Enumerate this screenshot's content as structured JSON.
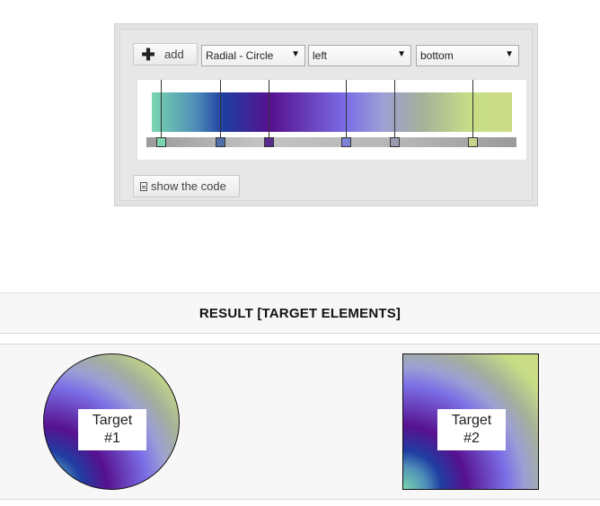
{
  "toolbar": {
    "add_label": "add",
    "gradient_type": "Radial - Circle",
    "horizontal_position": "left",
    "vertical_position": "bottom"
  },
  "gradient": {
    "stops": [
      {
        "position_percent": 4,
        "color": "#79d6ae"
      },
      {
        "position_percent": 20,
        "color": "#4f6fa8"
      },
      {
        "position_percent": 33,
        "color": "#5b2a8c"
      },
      {
        "position_percent": 54,
        "color": "#7b82d6"
      },
      {
        "position_percent": 67,
        "color": "#9a9ab0"
      },
      {
        "position_percent": 88,
        "color": "#c6d48e"
      }
    ]
  },
  "show_code_label": "show the code",
  "result": {
    "title": "RESULT [TARGET ELEMENTS]",
    "targets": [
      {
        "label": "Target\n#1"
      },
      {
        "label": "Target\n#2"
      }
    ]
  },
  "icons": {
    "add": "plus-icon",
    "code": "document-icon",
    "dropdown": "triangle-down"
  }
}
